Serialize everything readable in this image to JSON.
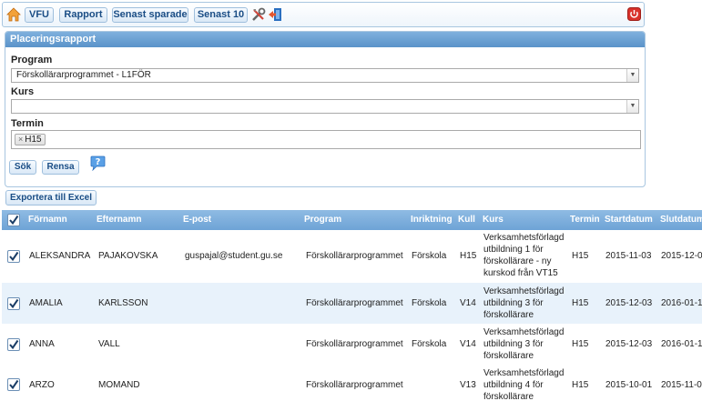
{
  "toolbar": {
    "buttons": [
      {
        "label": "VFU"
      },
      {
        "label": "Rapport"
      },
      {
        "label": "Senast sparade"
      },
      {
        "label": "Senast 10"
      }
    ]
  },
  "panel": {
    "title": "Placeringsrapport",
    "program_label": "Program",
    "program_value": "Förskollärarprogrammet - L1FÖR",
    "kurs_label": "Kurs",
    "kurs_value": "",
    "termin_label": "Termin",
    "termin_tag": "H15",
    "search_label": "Sök",
    "clear_label": "Rensa"
  },
  "export_label": "Exportera till Excel",
  "table": {
    "columns": [
      "Förnamn",
      "Efternamn",
      "E-post",
      "Program",
      "Inriktning",
      "Kull",
      "Kurs",
      "Termin",
      "Startdatum",
      "Slutdatum"
    ],
    "rows": [
      {
        "fornamn": "ALEKSANDRA",
        "efternamn": "PAJAKOVSKA",
        "epost": "guspajal@student.gu.se",
        "program": "Förskollärarprogrammet",
        "inriktning": "Förskola",
        "kull": "H15",
        "kurs": "Verksamhetsförlagd utbildning 1 för förskollärare - ny kurskod från VT15",
        "termin": "H15",
        "start": "2015-11-03",
        "slut": "2015-12-0"
      },
      {
        "fornamn": "AMALIA",
        "efternamn": "KARLSSON",
        "epost": "",
        "program": "Förskollärarprogrammet",
        "inriktning": "Förskola",
        "kull": "V14",
        "kurs": "Verksamhetsförlagd utbildning 3 för förskollärare",
        "termin": "H15",
        "start": "2015-12-03",
        "slut": "2016-01-1"
      },
      {
        "fornamn": "ANNA",
        "efternamn": "VALL",
        "epost": "",
        "program": "Förskollärarprogrammet",
        "inriktning": "Förskola",
        "kull": "V14",
        "kurs": "Verksamhetsförlagd utbildning 3 för förskollärare",
        "termin": "H15",
        "start": "2015-12-03",
        "slut": "2016-01-1"
      },
      {
        "fornamn": "ARZO",
        "efternamn": "MOMAND",
        "epost": "",
        "program": "Förskollärarprogrammet",
        "inriktning": "",
        "kull": "V13",
        "kurs": "Verksamhetsförlagd utbildning 4 för förskollärare",
        "termin": "H15",
        "start": "2015-10-01",
        "slut": "2015-11-0"
      }
    ]
  },
  "colors": {
    "header": "#6ea3d6",
    "accent": "#1a4d85",
    "row_alt": "#e8f2fb"
  }
}
